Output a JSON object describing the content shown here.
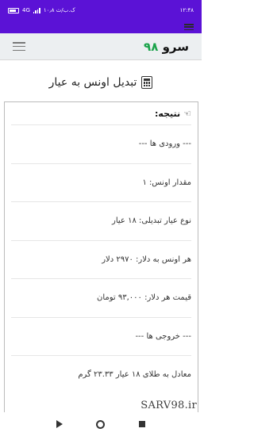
{
  "status_bar": {
    "time": "۱۲:۴۸",
    "left_info": "۱۰٫۸ ک.ب/ث",
    "network_label": "4G"
  },
  "header": {
    "logo_text": "سرو",
    "logo_number": "۹۸"
  },
  "page": {
    "title": "تبدیل اونس به عیار",
    "result_heading": "نتیجه:",
    "rows": [
      "--- ورودی ها ---",
      "مقدار اونس: ۱",
      "نوع عیار تبدیلی: ۱۸ عیار",
      "هر اونس به دلار: ۲۹۷۰ دلار",
      "قیمت هر دلار: ۹۳,۰۰۰ تومان",
      "--- خروجی ها ---",
      "معادل به طلای ۱۸ عیار ۲۳.۳۳ گرم"
    ]
  },
  "watermark": "SARV98.ir",
  "colors": {
    "status_bar": "#5b12d6",
    "header_bg": "#eceff1",
    "logo_number": "#1aa34a"
  }
}
